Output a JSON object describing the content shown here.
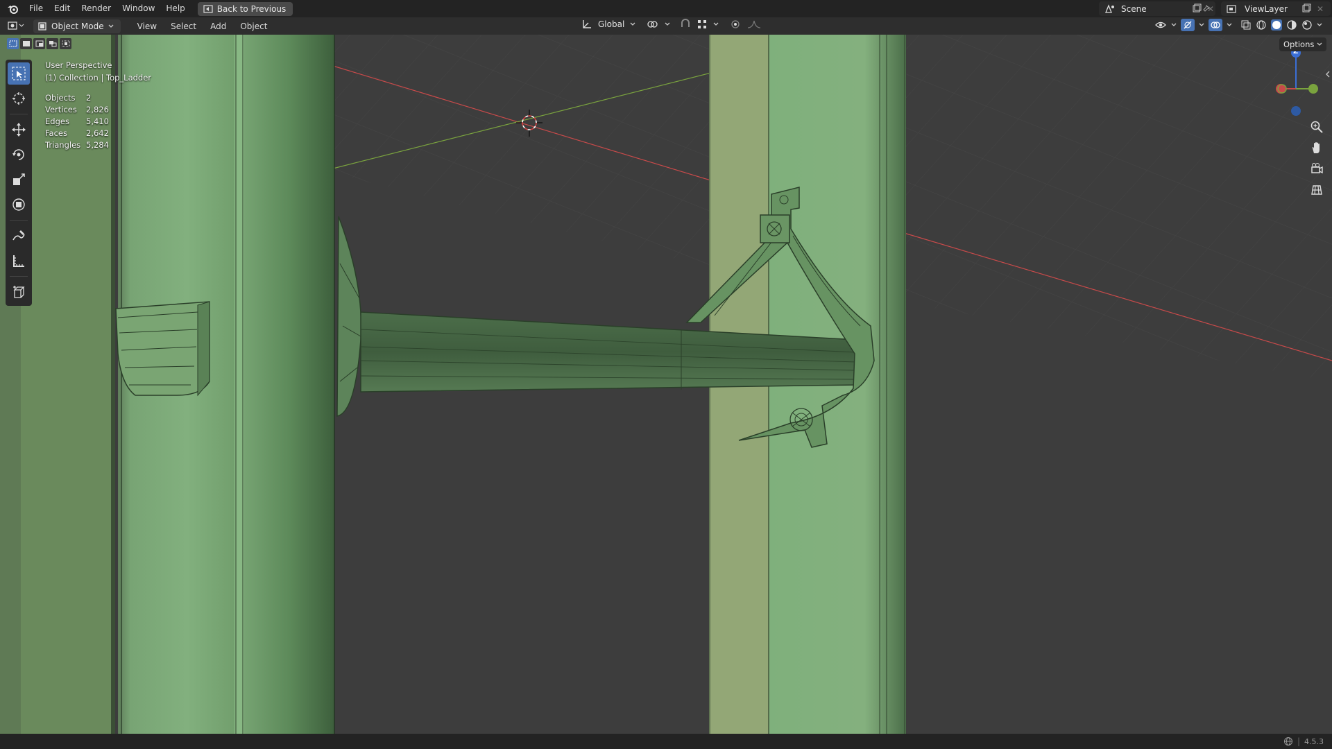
{
  "topbar": {
    "menus": [
      "File",
      "Edit",
      "Render",
      "Window",
      "Help"
    ],
    "back_button": "Back to Previous",
    "scene": "Scene",
    "view_layer": "ViewLayer"
  },
  "header": {
    "mode": "Object Mode",
    "menus": [
      "View",
      "Select",
      "Add",
      "Object"
    ],
    "transform_orientation": "Global",
    "options_label": "Options"
  },
  "viewport": {
    "perspective": "User Perspective",
    "collection": "(1) Collection | Top_Ladder",
    "stats": [
      {
        "label": "Objects",
        "value": "2"
      },
      {
        "label": "Vertices",
        "value": "2,826"
      },
      {
        "label": "Edges",
        "value": "5,410"
      },
      {
        "label": "Faces",
        "value": "2,642"
      },
      {
        "label": "Triangles",
        "value": "5,284"
      }
    ],
    "gizmo_axis_label": "Z"
  },
  "statusbar": {
    "version": "4.5.3"
  },
  "colors": {
    "accent": "#4772b3",
    "mesh_green": "#7aa67a",
    "x_axis": "#c84a4a",
    "y_axis": "#7aa33e"
  }
}
